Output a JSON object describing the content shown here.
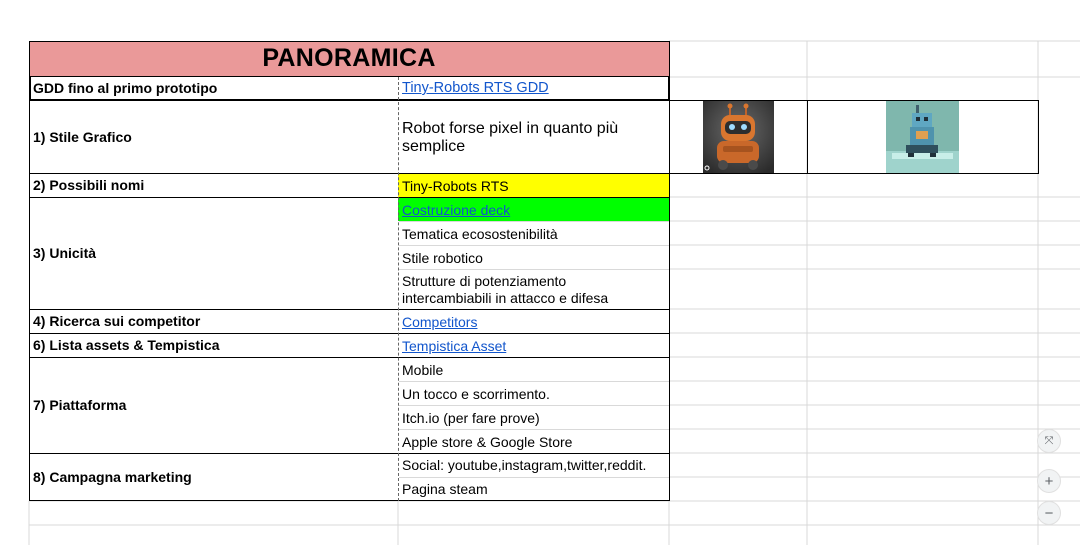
{
  "sheet": {
    "title": "PANORAMICA",
    "rows": [
      {
        "label": "GDD fino al primo prototipo",
        "values": [
          "Tiny-Robots RTS GDD"
        ]
      },
      {
        "label": "1) Stile Grafico",
        "values": [
          "Robot forse pixel in quanto più",
          "semplice"
        ]
      },
      {
        "label": "2) Possibili nomi",
        "values": [
          "Tiny-Robots RTS"
        ]
      },
      {
        "label": "3) Unicità",
        "values": [
          "Costruzione deck",
          "Tematica ecosostenibilità",
          "Stile robotico",
          "Strutture di potenziamento",
          "intercambiabili in attacco e difesa"
        ]
      },
      {
        "label": "4) Ricerca sui competitor",
        "values": [
          "Competitors"
        ]
      },
      {
        "label": "6) Lista assets & Tempistica",
        "values": [
          "Tempistica Asset"
        ]
      },
      {
        "label": "7) Piattaforma",
        "values": [
          "Mobile",
          "Un tocco e scorrimento.",
          "Itch.io (per fare prove)",
          "Apple store & Google Store"
        ]
      },
      {
        "label": "8) Campagna marketing",
        "values": [
          "Social: youtube,instagram,twitter,reddit.",
          "Pagina steam"
        ]
      }
    ]
  },
  "colors": {
    "header_bg": "#ea9999",
    "highlight_yellow": "#ffff00",
    "highlight_green": "#00ff00",
    "link": "#1155cc",
    "gridline": "#d9d9d9"
  },
  "images": [
    {
      "name": "orange-robot-image"
    },
    {
      "name": "blue-robot-image"
    }
  ],
  "zoom_controls": {
    "fit_icon": "⤧",
    "zoom_in": "+",
    "zoom_out": "−"
  }
}
